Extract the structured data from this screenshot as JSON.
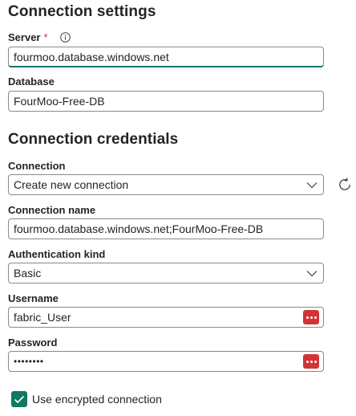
{
  "connection_settings": {
    "title": "Connection settings",
    "server": {
      "label": "Server",
      "required_mark": "*",
      "value": "fourmoo.database.windows.net"
    },
    "database": {
      "label": "Database",
      "value": "FourMoo-Free-DB"
    }
  },
  "connection_credentials": {
    "title": "Connection credentials",
    "connection": {
      "label": "Connection",
      "selected": "Create new connection"
    },
    "connection_name": {
      "label": "Connection name",
      "value": "fourmoo.database.windows.net;FourMoo-Free-DB"
    },
    "authentication_kind": {
      "label": "Authentication kind",
      "selected": "Basic"
    },
    "username": {
      "label": "Username",
      "value": "fabric_User"
    },
    "password": {
      "label": "Password",
      "value": "••••••••"
    },
    "encrypted": {
      "label": "Use encrypted connection",
      "checked": true
    }
  },
  "icons": {
    "info": "info-icon",
    "dropdown": "chevron-down-icon",
    "refresh": "refresh-icon",
    "key_vault": "more-icon",
    "check": "checkmark-icon"
  },
  "colors": {
    "accent": "#117865",
    "key_button": "#d13438",
    "required": "#c4314b"
  }
}
